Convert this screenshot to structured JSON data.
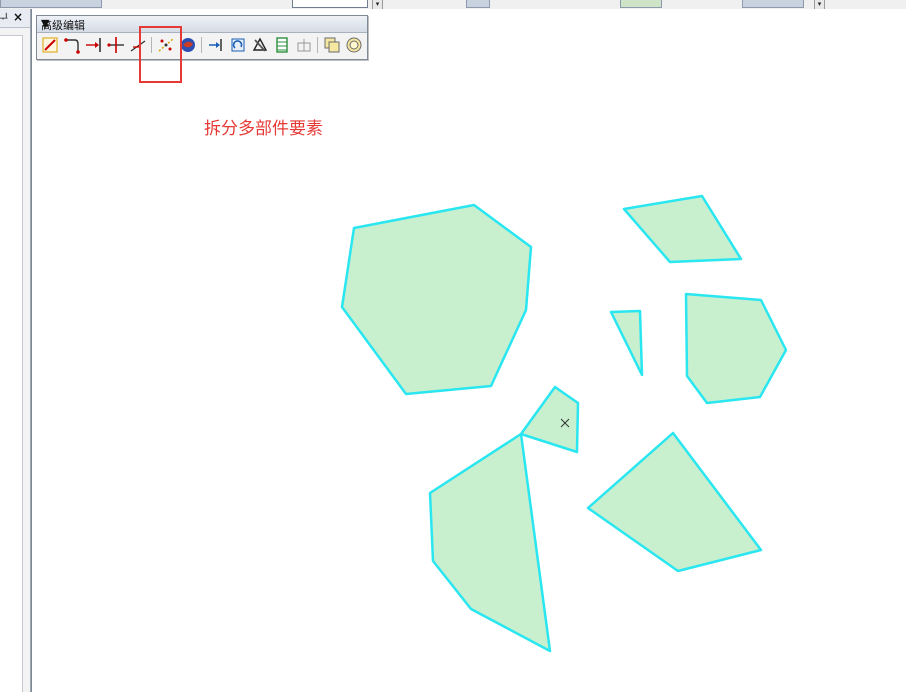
{
  "toolbar": {
    "title": "高级编辑",
    "menu_arrow": "▼",
    "close": "×",
    "tools": [
      {
        "name": "copy-features-tool-icon"
      },
      {
        "name": "fillet-tool-icon"
      },
      {
        "name": "extend-tool-icon"
      },
      {
        "name": "trim-tool-icon"
      },
      {
        "name": "line-intersection-tool-icon"
      },
      {
        "name": "explode-multipart-feature-icon"
      },
      {
        "name": "construct-geodatabase-icon"
      },
      {
        "name": "align-to-shape-icon"
      },
      {
        "name": "replace-geometry-icon"
      },
      {
        "name": "construct-features-icon"
      },
      {
        "name": "smooth-icon"
      },
      {
        "name": "generalize-icon"
      },
      {
        "name": "rectangle-icon"
      },
      {
        "name": "circle-icon"
      }
    ]
  },
  "left_panel": {
    "pin": "ᆛ",
    "close": "×"
  },
  "annotation": {
    "text": "拆分多部件要素"
  },
  "colors": {
    "polygon_fill": "#c8f0ce",
    "polygon_stroke": "#29e6f0",
    "highlight": "#e53935"
  }
}
